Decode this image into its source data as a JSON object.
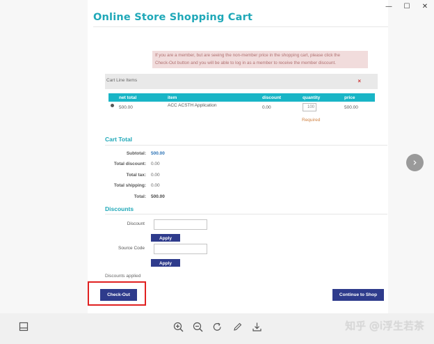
{
  "window": {
    "minimize": "—",
    "maximize": "☐",
    "close": "✕"
  },
  "header": {
    "title": "Online Store Shopping Cart"
  },
  "notice": {
    "line1": "If you are a member, but are seeing the non-member price in the shopping cart, please click the",
    "line2": "Check-Out button and you will be able to log in as a member to receive the member discount."
  },
  "cart": {
    "bar_label": "Cart Line Items",
    "remove_icon": "×",
    "columns": [
      "net total",
      "item",
      "discount",
      "quantity",
      "price"
    ],
    "rows": [
      {
        "net_total": "500.00",
        "item": "ACC ACSTH Application",
        "discount": "0.00",
        "quantity": "100",
        "price": "500.00"
      }
    ],
    "required": "Required"
  },
  "totals": {
    "title": "Cart Total",
    "rows": [
      {
        "label": "Subtotal:",
        "value": "500.00"
      },
      {
        "label": "Total discount:",
        "value": "0.00"
      },
      {
        "label": "Total tax:",
        "value": "0.00"
      },
      {
        "label": "Total shipping:",
        "value": "0.00"
      },
      {
        "label": "Total:",
        "value": "500.00"
      }
    ]
  },
  "discounts": {
    "title": "Discounts",
    "discount_label": "Discount",
    "source_label": "Source Code",
    "apply_label": "Apply",
    "applied_label": "Discounts applied"
  },
  "actions": {
    "checkout": "Check-Out",
    "continue": "Continue to Shop"
  },
  "viewer": {
    "next_icon": "›"
  },
  "toolbar": {
    "icons": [
      "panel-icon",
      "zoom-in-icon",
      "zoom-out-icon",
      "rotate-icon",
      "edit-icon",
      "download-icon"
    ],
    "watermark": "知乎 @i浮生若茶"
  },
  "colors": {
    "accent": "#1fa8b8",
    "button": "#2e3b8c",
    "highlight": "#e02020"
  }
}
